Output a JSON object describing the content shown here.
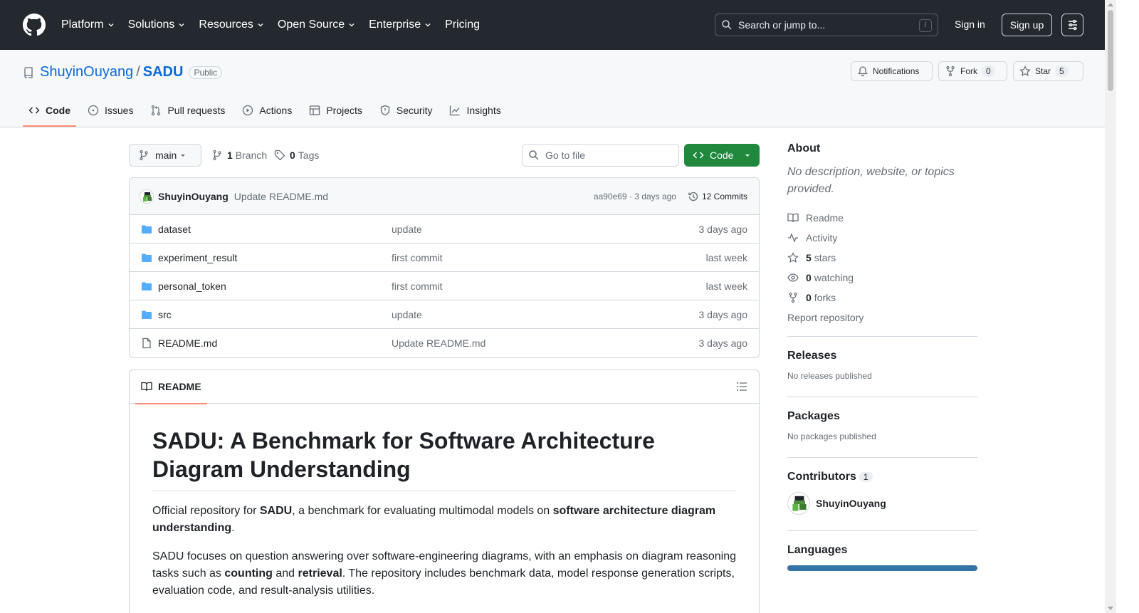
{
  "header": {
    "nav": [
      "Platform",
      "Solutions",
      "Resources",
      "Open Source",
      "Enterprise",
      "Pricing"
    ],
    "search_placeholder": "Search or jump to...",
    "search_key": "/",
    "signin": "Sign in",
    "signup": "Sign up"
  },
  "repo": {
    "owner": "ShuyinOuyang",
    "sep": "/",
    "name": "SADU",
    "visibility": "Public",
    "notifications": "Notifications",
    "fork_label": "Fork",
    "fork_count": "0",
    "star_label": "Star",
    "star_count": "5"
  },
  "tabs": [
    "Code",
    "Issues",
    "Pull requests",
    "Actions",
    "Projects",
    "Security",
    "Insights"
  ],
  "toolbar": {
    "branch": "main",
    "branch_count": "1",
    "branch_label": "Branch",
    "tag_count": "0",
    "tag_label": "Tags",
    "goto_placeholder": "Go to file",
    "code_button": "Code"
  },
  "commit": {
    "author": "ShuyinOuyang",
    "message": "Update README.md",
    "meta": "aa90e69 · 3 days ago",
    "commits": "12 Commits"
  },
  "files": [
    {
      "name": "dataset",
      "type": "dir",
      "message": "update",
      "date": "3 days ago"
    },
    {
      "name": "experiment_result",
      "type": "dir",
      "message": "first commit",
      "date": "last week"
    },
    {
      "name": "personal_token",
      "type": "dir",
      "message": "first commit",
      "date": "last week"
    },
    {
      "name": "src",
      "type": "dir",
      "message": "update",
      "date": "3 days ago"
    },
    {
      "name": "README.md",
      "type": "file",
      "message": "Update README.md",
      "date": "3 days ago"
    }
  ],
  "readme": {
    "tab": "README",
    "title": "SADU: A Benchmark for Software Architecture Diagram Understanding",
    "p1_a": "Official repository for ",
    "p1_b": "SADU",
    "p1_c": ", a benchmark for evaluating multimodal models on ",
    "p1_d": "software architecture diagram understanding",
    "p1_e": ".",
    "p2_a": "SADU focuses on question answering over software-engineering diagrams, with an emphasis on diagram reasoning tasks such as ",
    "p2_b": "counting",
    "p2_c": " and ",
    "p2_d": "retrieval",
    "p2_e": ". The repository includes benchmark data, model response generation scripts, evaluation code, and result-analysis utilities."
  },
  "about": {
    "title": "About",
    "description": "No description, website, or topics provided.",
    "readme": "Readme",
    "activity": "Activity",
    "stars_count": "5",
    "stars_label": "stars",
    "watching_count": "0",
    "watching_label": "watching",
    "forks_count": "0",
    "forks_label": "forks",
    "report": "Report repository"
  },
  "releases": {
    "title": "Releases",
    "text": "No releases published"
  },
  "packages": {
    "title": "Packages",
    "text": "No packages published"
  },
  "contributors": {
    "title": "Contributors",
    "count": "1",
    "name": "ShuyinOuyang"
  },
  "languages": {
    "title": "Languages",
    "color": "#3572A5"
  }
}
